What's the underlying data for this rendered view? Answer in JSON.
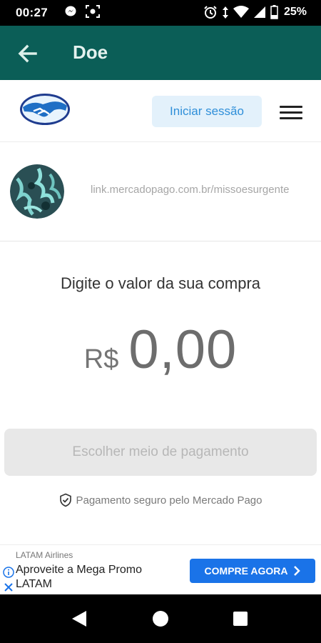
{
  "status_bar": {
    "time": "00:27",
    "battery": "25%",
    "icons": [
      "messenger-icon",
      "screenshot-icon",
      "alarm-icon",
      "data-arrows-icon",
      "wifi-icon",
      "signal-icon",
      "battery-icon"
    ]
  },
  "app_bar": {
    "title": "Doe",
    "back_icon": "arrow-left-icon"
  },
  "header": {
    "logo": "mercado-pago-handshake-logo",
    "login_label": "Iniciar sessão",
    "menu_icon": "hamburger-icon"
  },
  "profile": {
    "link": "link.mercadopago.com.br/missoesurgente"
  },
  "payment": {
    "prompt": "Digite o valor da sua compra",
    "currency": "R$",
    "amount": "0,00",
    "button_label": "Escolher meio de pagamento",
    "secure_text": "Pagamento seguro pelo Mercado Pago"
  },
  "ad": {
    "advertiser": "LATAM Airlines",
    "headline": "Aproveite a Mega Promo LATAM",
    "cta_label": "COMPRE AGORA"
  },
  "colors": {
    "app_bar": "#0b5e57",
    "login_bg": "#e3f1fb",
    "login_text": "#2f8fd9",
    "cta": "#1a73e8"
  }
}
